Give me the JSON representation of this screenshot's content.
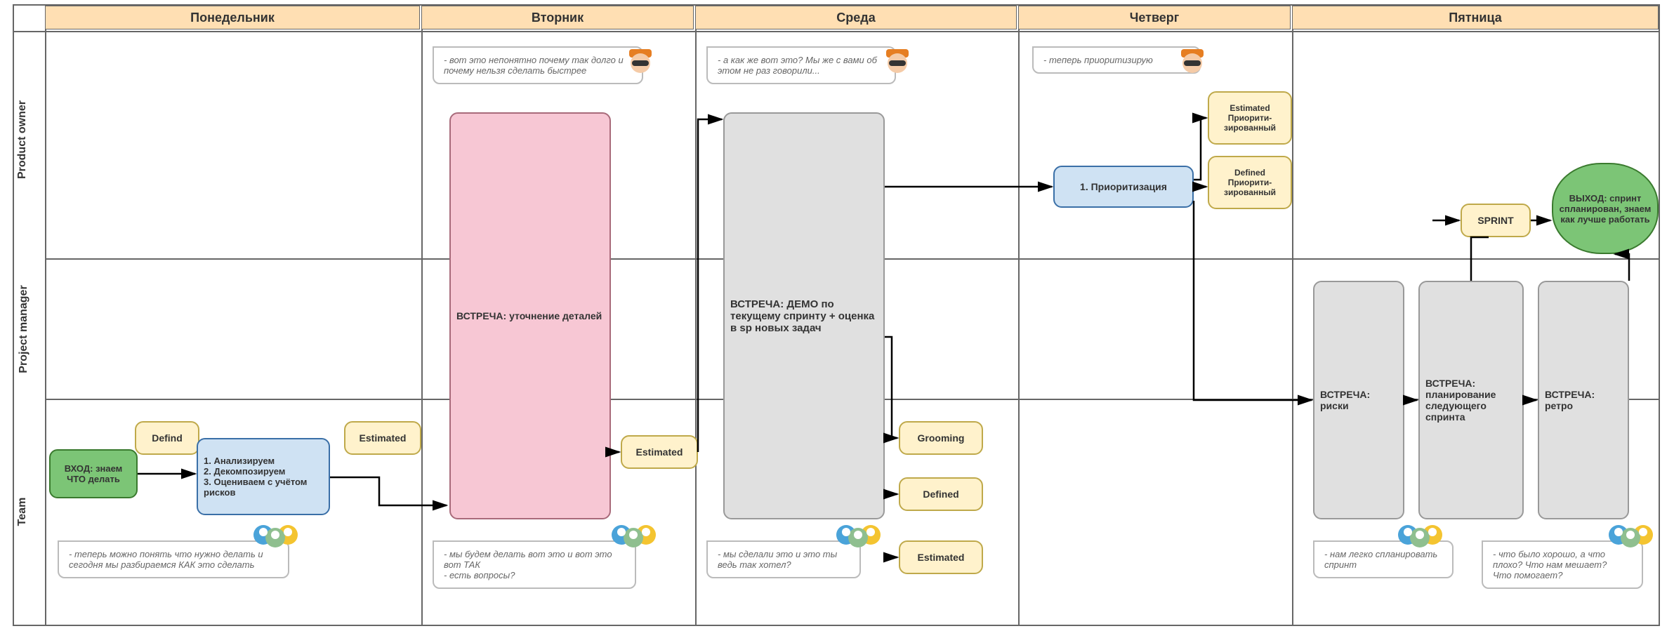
{
  "days": {
    "mon": "Понедельник",
    "tue": "Вторник",
    "wed": "Среда",
    "thu": "Четверг",
    "fri": "Пятница"
  },
  "lanes": {
    "po": "Product owner",
    "pm": "Project manager",
    "team": "Team"
  },
  "blocks": {
    "entry": "ВХОД: знаем ЧТО делать",
    "defind": "Defind",
    "analyze": "1. Анализируем\n2. Декомпозируем\n3. Оцениваем с учётом рисков",
    "estimated1": "Estimated",
    "meeting_detail": "ВСТРЕЧА: уточнение деталей",
    "estimated2": "Estimated",
    "meeting_demo": "ВСТРЕЧА: ДЕМО по текущему спринту + оценка в sp новых задач",
    "grooming": "Grooming",
    "defined3": "Defined",
    "estimated3": "Estimated",
    "priority": "1. Приоритизация",
    "est_prio": "Estimated Приорити-зированный",
    "def_prio": "Defined Приорити-зированный",
    "risks": "ВСТРЕЧА: риски",
    "planning": "ВСТРЕЧА: планирование следующего спринта",
    "retro": "ВСТРЕЧА: ретро",
    "sprint": "SPRINT",
    "exit": "ВЫХОД: спринт спланирован, знаем как лучше работать"
  },
  "comments": {
    "team_mon": "- теперь можно понять что нужно делать и сегодня мы разбираемся КАК это сделать",
    "po_tue": "- вот это непонятно почему так долго и почему нельзя сделать быстрее",
    "team_tue": "- мы будем делать вот это и вот это вот ТАК\n- есть вопросы?",
    "po_wed": "- а как же вот это? Мы же с вами об этом не раз говорили...",
    "team_wed": "- мы сделали это и это ты ведь так хотел?",
    "po_thu": "- теперь приоритизирую",
    "team_fri1": "- нам легко спланировать спринт",
    "team_fri2": "- что было хорошо, а что плохо? Что нам мешает?\nЧто помогает?"
  }
}
